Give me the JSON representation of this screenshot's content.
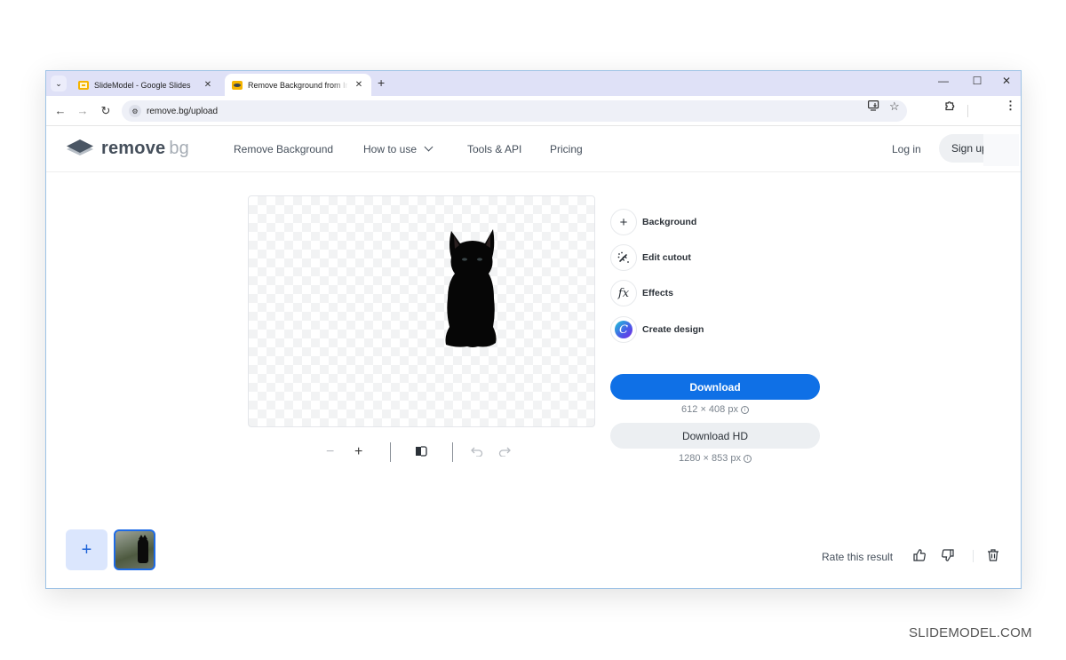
{
  "browser": {
    "tabs": [
      {
        "title": "SlideModel - Google Slides",
        "favicon": "google-slides-icon",
        "active": false
      },
      {
        "title": "Remove Background from Image",
        "favicon": "removebg-icon",
        "active": true
      }
    ],
    "new_tab_label": "+",
    "url": "remove.bg/upload",
    "icons": {
      "back": "←",
      "forward": "→",
      "reload": "↻",
      "minimize": "—",
      "maximize": "☐",
      "close": "✕",
      "bookmark": "☆",
      "menu": "⋮"
    }
  },
  "site": {
    "logo": {
      "word": "remove",
      "suffix": "bg"
    },
    "nav": [
      {
        "label": "Remove Background"
      },
      {
        "label": "How to use",
        "has_dropdown": true
      },
      {
        "label": "Tools & API"
      },
      {
        "label": "Pricing"
      }
    ],
    "login_label": "Log in",
    "signup_label": "Sign up"
  },
  "editor": {
    "actions": [
      {
        "label": "Background",
        "icon": "plus-icon",
        "glyph": "+"
      },
      {
        "label": "Edit cutout",
        "icon": "magic-wand-icon",
        "glyph": "✎"
      },
      {
        "label": "Effects",
        "icon": "fx-icon",
        "glyph": "fx"
      },
      {
        "label": "Create design",
        "icon": "canva-icon",
        "glyph": "C"
      }
    ],
    "download": {
      "label": "Download",
      "size": "612 × 408 px"
    },
    "download_hd": {
      "label": "Download HD",
      "size": "1280 × 853 px"
    },
    "viewer_tools": {
      "zoom_out": "−",
      "zoom_in": "+"
    },
    "accent_color": "#0f70e6"
  },
  "bottom": {
    "add_label": "+",
    "rate_label": "Rate this result"
  },
  "watermark": "SLIDEMODEL.COM"
}
